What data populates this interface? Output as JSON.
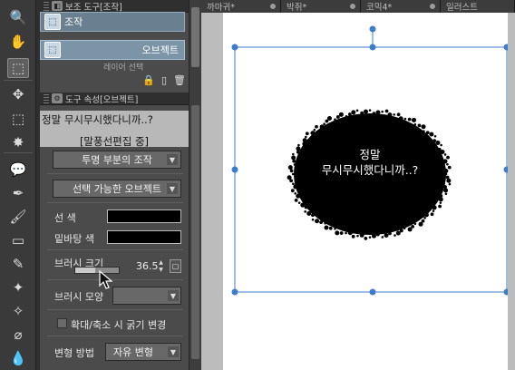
{
  "tabs": [
    {
      "label": "까마귀*"
    },
    {
      "label": "박쥐*"
    },
    {
      "label": "코믹4*"
    },
    {
      "label": "일러스트"
    }
  ],
  "tools": [
    {
      "icon": "magnifier-icon",
      "glyph": "🔍"
    },
    {
      "icon": "hand-icon",
      "glyph": "✋"
    },
    {
      "icon": "object-select-icon",
      "glyph": "⬚",
      "active": true
    },
    {
      "icon": "layer-move-icon",
      "glyph": "✥"
    },
    {
      "icon": "marquee-icon",
      "glyph": "⬚"
    },
    {
      "icon": "auto-select-icon",
      "glyph": "✸"
    },
    {
      "icon": "balloon-icon",
      "glyph": "💬"
    },
    {
      "icon": "pen-icon",
      "glyph": "✒"
    },
    {
      "icon": "brush-icon",
      "glyph": "🖌"
    },
    {
      "icon": "eraser-icon",
      "glyph": "▭"
    },
    {
      "icon": "blend-icon",
      "glyph": "✎"
    },
    {
      "icon": "stamp-icon",
      "glyph": "✦"
    },
    {
      "icon": "sparkle-icon",
      "glyph": "✧"
    },
    {
      "icon": "fill-icon",
      "glyph": "⌀"
    },
    {
      "icon": "drop-icon",
      "glyph": "💧"
    }
  ],
  "subtool_panel": {
    "title": "보조 도구[조작]",
    "items": [
      {
        "label": "조작",
        "active": true
      },
      {
        "label": "오브젝트",
        "selected": true
      },
      {
        "label": "레이어 선택"
      }
    ]
  },
  "property_panel": {
    "title": "도구 속성[오브젝트]",
    "text_preview_line1": "정말 무시무시했다니까..?",
    "text_preview_line2": "[말풍선편집 중]",
    "transparent_dropdown": "투명 부분의 조작",
    "selectable_dropdown": "선택 가능한 오브젝트",
    "line_color_label": "선 색",
    "bg_color_label": "밑바탕 색",
    "line_color": "#000000",
    "bg_color": "#000000",
    "brush_size_label": "브러시 크기",
    "brush_size_value": "36.5",
    "brush_size_fraction": 0.45,
    "brush_shape_label": "브러시 모양",
    "scale_checkbox_label": "확대/축소 시 굵기 변경",
    "transform_label": "변형 방법",
    "transform_value": "자유 변형"
  },
  "canvas": {
    "bubble_text_line1": "정말",
    "bubble_text_line2": "무시무시했다니까..?",
    "selection_color": "#3d7cc9"
  }
}
